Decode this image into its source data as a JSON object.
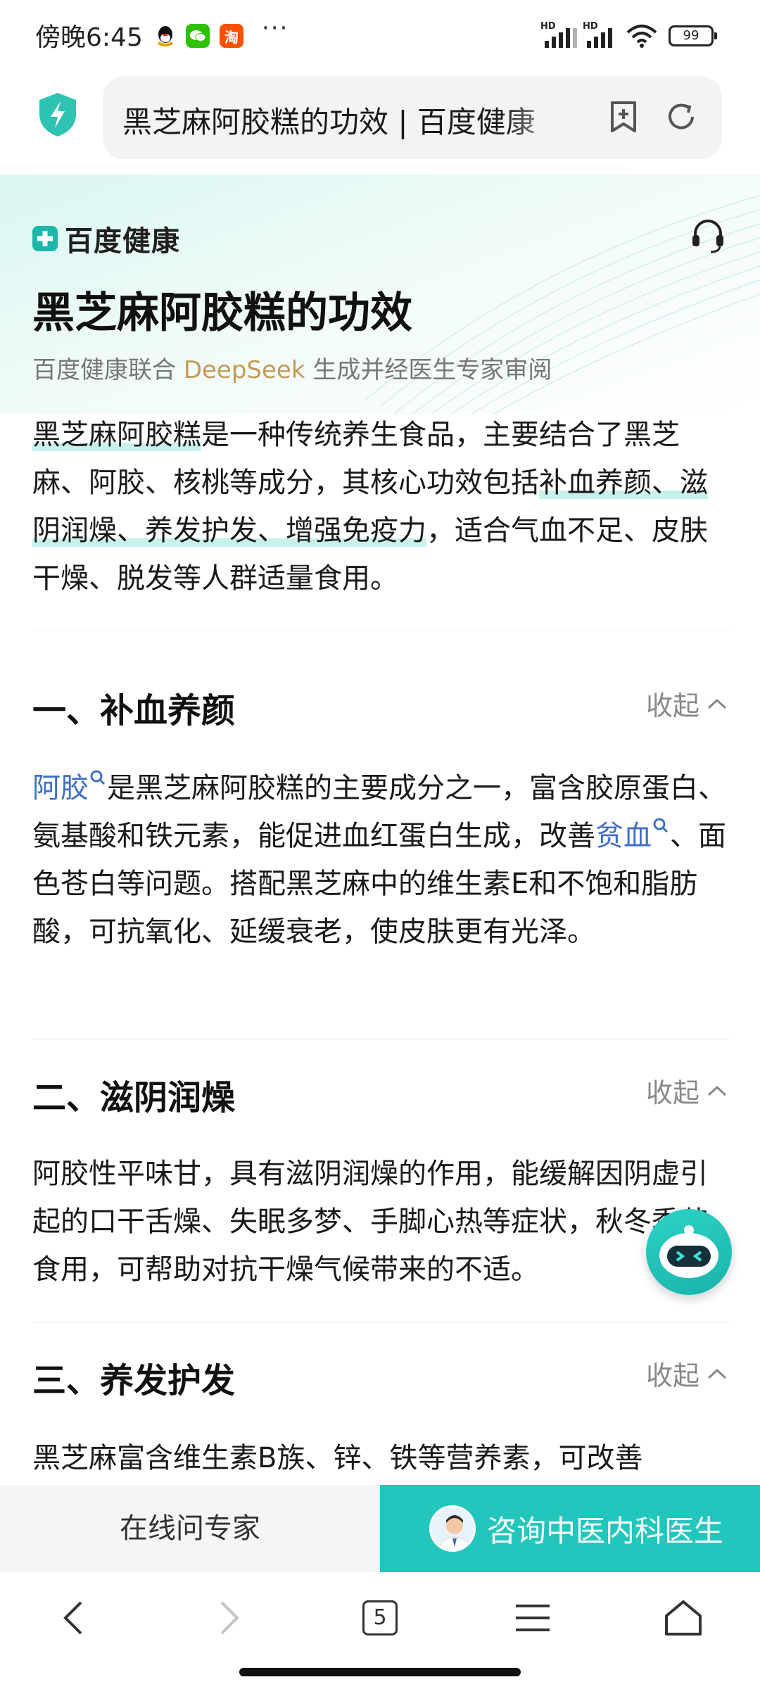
{
  "status_bar": {
    "time": "傍晚6:45",
    "more": "···",
    "battery": "99",
    "signal_label": "HD"
  },
  "address_bar": {
    "url_title": "黑芝麻阿胶糕的功效 | 百度健康",
    "icons": [
      "shield-icon",
      "add-bookmark-icon",
      "refresh-icon"
    ]
  },
  "hero": {
    "brand": "百度健康",
    "title": "黑芝麻阿胶糕的功效",
    "subtitle_pre": "百度健康联合 ",
    "subtitle_ds": "DeepSeek",
    "subtitle_post": " 生成并经医生专家审阅"
  },
  "summary": {
    "part1": "黑芝麻阿胶糕",
    "part2": "是一种传统养生食品，主要结合了黑芝麻、阿胶、核桃等成分，其核心功效包括",
    "part3": "补血养颜、滋阴润燥、养发护发、增强免疫力",
    "part4": "，适合气血不足、皮肤干燥、脱发等人群适量食用。"
  },
  "sections": [
    {
      "title": "一、补血养颜",
      "collapse": "收起",
      "link1": "阿胶",
      "text1": "是黑芝麻阿胶糕的主要成分之一，富含胶原蛋白、氨基酸和铁元素，能促进血红蛋白生成，改善",
      "link2": "贫血",
      "text2": "、面色苍白等问题。搭配黑芝麻中的维生素E和不饱和脂肪酸，可抗氧化、延缓衰老，使皮肤更有光泽。"
    },
    {
      "title": "二、滋阴润燥",
      "collapse": "收起",
      "text": "阿胶性平味甘，具有滋阴润燥的作用，能缓解因阴虚引起的口干舌燥、失眠多梦、手脚心热等症状，秋冬季节食用，可帮助对抗干燥气候带来的不适。"
    },
    {
      "title": "三、养发护发",
      "collapse": "收起",
      "text": "黑芝麻富含维生素B族、锌、铁等营养素，可改善"
    }
  ],
  "actions": {
    "ask_expert": "在线问专家",
    "consult": "咨询中医内科医生"
  },
  "nav": {
    "tab_count": "5"
  },
  "colors": {
    "accent": "#23c6bc",
    "link": "#3f6fc4",
    "highlight": "#c9f1ec",
    "deepseek": "#c49a56"
  }
}
